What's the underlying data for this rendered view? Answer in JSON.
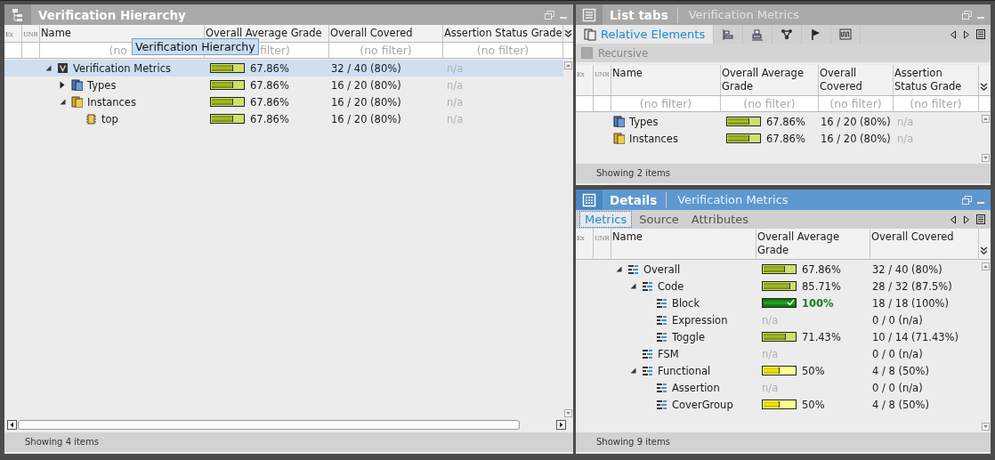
{
  "left_panel": {
    "title": "Verification Hierarchy",
    "tooltip": "Verification Hierarchy",
    "table": {
      "columns": [
        "Ex",
        "UNR",
        "Name",
        "Overall Average Grade",
        "Overall Covered",
        "Assertion Status Grade"
      ],
      "filters": [
        "(no",
        "filter)",
        "(no filter)",
        "(no filter)"
      ],
      "rows": [
        {
          "kind": "metrics",
          "name": "Verification Metrics",
          "selected": true,
          "expanded": true,
          "grade": {
            "kind": "olive",
            "level": 0.68,
            "text": "67.86%"
          },
          "covered": "32 / 40 (80%)",
          "assertion": "n/a",
          "children": [
            {
              "kind": "types",
              "name": "Types",
              "selected": false,
              "expanded": false,
              "grade": {
                "kind": "olive",
                "level": 0.68,
                "text": "67.86%"
              },
              "covered": "16 / 20 (80%)",
              "assertion": "n/a"
            },
            {
              "kind": "instances",
              "name": "Instances",
              "selected": false,
              "expanded": true,
              "grade": {
                "kind": "olive",
                "level": 0.68,
                "text": "67.86%"
              },
              "covered": "16 / 20 (80%)",
              "assertion": "n/a",
              "children": [
                {
                  "kind": "module",
                  "name": "top",
                  "selected": false,
                  "grade": {
                    "kind": "olive",
                    "level": 0.68,
                    "text": "67.86%"
                  },
                  "covered": "16 / 20 (80%)",
                  "assertion": "n/a"
                }
              ]
            }
          ]
        }
      ]
    },
    "status": "Showing 4 items"
  },
  "list_panel": {
    "title": "List tabs",
    "subtitle": "Verification Metrics",
    "tabs": [
      {
        "kind": "elements",
        "label": "Relative Elements",
        "selected": true
      },
      {
        "kind": "align",
        "selected": false
      },
      {
        "kind": "stack",
        "selected": false
      },
      {
        "kind": "graph",
        "selected": false
      },
      {
        "kind": "flag",
        "selected": false
      },
      {
        "kind": "wave",
        "selected": false
      }
    ],
    "recursive": {
      "label": "Recursive",
      "checked": false,
      "disabled": true
    },
    "table": {
      "columns": [
        "Ex",
        "UNR",
        "Name",
        "Overall Average Grade",
        "Overall Covered",
        "Assertion Status Grade"
      ],
      "filters": [
        "(no filter)",
        "(no filter)",
        "(no filter)",
        "(no filter)"
      ],
      "rows": [
        {
          "kind": "types",
          "name": "Types",
          "selected": false,
          "grade": {
            "kind": "olive",
            "level": 0.68,
            "text": "67.86%"
          },
          "covered": "16 / 20 (80%)",
          "assertion": "n/a"
        },
        {
          "kind": "instances",
          "name": "Instances",
          "selected": false,
          "grade": {
            "kind": "olive",
            "level": 0.68,
            "text": "67.86%"
          },
          "covered": "16 / 20 (80%)",
          "assertion": "n/a"
        }
      ]
    },
    "status": "Showing 2 items"
  },
  "details_panel": {
    "title": "Details",
    "subtitle": "Verification Metrics",
    "tabs": [
      {
        "label": "Metrics",
        "selected": true
      },
      {
        "label": "Source",
        "selected": false
      },
      {
        "label": "Attributes",
        "selected": false
      }
    ],
    "table": {
      "columns": [
        "Ex",
        "UNR",
        "Name",
        "Overall Average Grade",
        "Overall Covered"
      ],
      "rows": [
        {
          "kind": "metric",
          "name": "Overall",
          "selected": false,
          "expanded": true,
          "grade": {
            "kind": "olive",
            "level": 0.68,
            "text": "67.86%"
          },
          "covered": "32 / 40 (80%)",
          "children": [
            {
              "kind": "metric",
              "name": "Code",
              "selected": false,
              "expanded": true,
              "grade": {
                "kind": "olive",
                "level": 0.86,
                "text": "85.71%"
              },
              "covered": "28 / 32 (87.5%)",
              "children": [
                {
                  "kind": "metric",
                  "name": "Block",
                  "selected": false,
                  "grade": {
                    "kind": "full",
                    "level": 1,
                    "text": "100%"
                  },
                  "covered": "18 / 18 (100%)"
                },
                {
                  "kind": "metric",
                  "name": "Expression",
                  "selected": false,
                  "grade": {
                    "kind": "none",
                    "text": "n/a"
                  },
                  "covered": "0 / 0 (n/a)"
                },
                {
                  "kind": "metric",
                  "name": "Toggle",
                  "selected": false,
                  "grade": {
                    "kind": "olive",
                    "level": 0.71,
                    "text": "71.43%"
                  },
                  "covered": "10 / 14 (71.43%)"
                }
              ]
            },
            {
              "kind": "metric",
              "name": "FSM",
              "selected": false,
              "grade": {
                "kind": "none",
                "text": "n/a"
              },
              "covered": "0 / 0 (n/a)"
            },
            {
              "kind": "metric",
              "name": "Functional",
              "selected": false,
              "expanded": true,
              "grade": {
                "kind": "yellow",
                "level": 0.5,
                "text": "50%"
              },
              "covered": "4 / 8 (50%)",
              "children": [
                {
                  "kind": "metric",
                  "name": "Assertion",
                  "selected": false,
                  "grade": {
                    "kind": "none",
                    "text": "n/a"
                  },
                  "covered": "0 / 0 (n/a)"
                },
                {
                  "kind": "metric",
                  "name": "CoverGroup",
                  "selected": false,
                  "grade": {
                    "kind": "yellow",
                    "level": 0.5,
                    "text": "50%"
                  },
                  "covered": "4 / 8 (50%)"
                }
              ]
            }
          ]
        }
      ]
    },
    "status": "Showing 9 items"
  }
}
